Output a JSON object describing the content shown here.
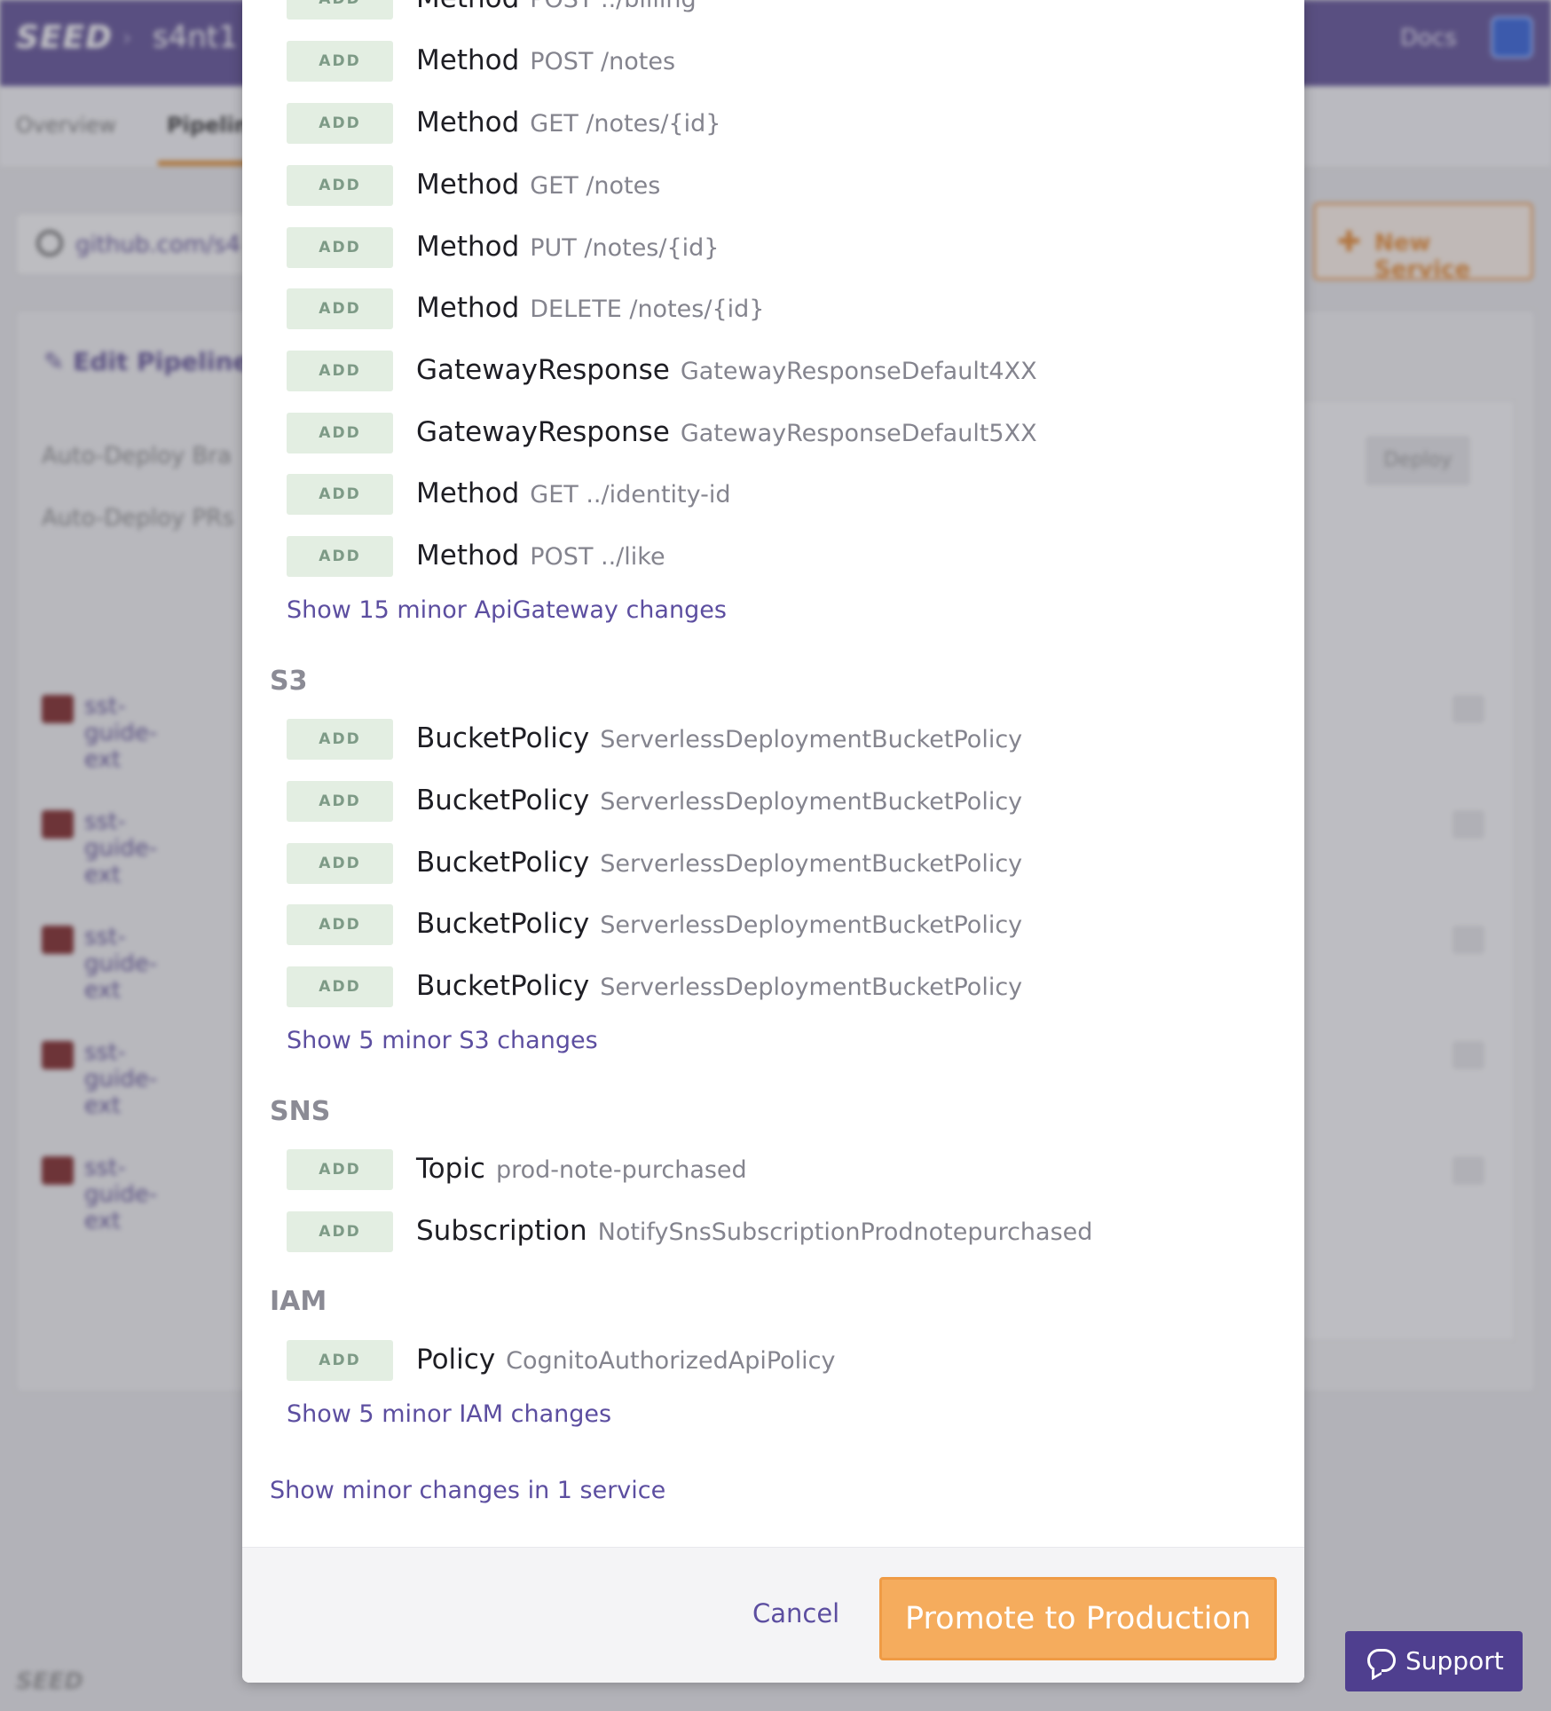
{
  "app": {
    "logo": "SEED",
    "crumb": "s4nt1",
    "docs_label": "Docs",
    "tabs": [
      "Overview",
      "Pipeline"
    ],
    "repo": "github.com/s4",
    "new_service_label": "New Service",
    "edit_pipeline_label": "Edit Pipeline",
    "auto_deploy_branch": "Auto-Deploy Bra",
    "auto_deploy_prs": "Auto-Deploy PRs",
    "deploy_label": "Deploy",
    "service_name": "sst-guide-ext",
    "footer_logo": "SEED"
  },
  "modal": {
    "badge_label": "ADD",
    "top_partial": {
      "type": "Method",
      "name": "POST ../billing"
    },
    "apigateway_changes": [
      {
        "type": "Method",
        "name": "POST /notes"
      },
      {
        "type": "Method",
        "name": "GET /notes/{id}"
      },
      {
        "type": "Method",
        "name": "GET /notes"
      },
      {
        "type": "Method",
        "name": "PUT /notes/{id}"
      },
      {
        "type": "Method",
        "name": "DELETE /notes/{id}"
      },
      {
        "type": "GatewayResponse",
        "name": "GatewayResponseDefault4XX"
      },
      {
        "type": "GatewayResponse",
        "name": "GatewayResponseDefault5XX"
      },
      {
        "type": "Method",
        "name": "GET ../identity-id"
      },
      {
        "type": "Method",
        "name": "POST ../like"
      }
    ],
    "apigateway_minor_link": "Show 15 minor ApiGateway changes",
    "s3": {
      "title": "S3",
      "changes": [
        {
          "type": "BucketPolicy",
          "name": "ServerlessDeploymentBucketPolicy"
        },
        {
          "type": "BucketPolicy",
          "name": "ServerlessDeploymentBucketPolicy"
        },
        {
          "type": "BucketPolicy",
          "name": "ServerlessDeploymentBucketPolicy"
        },
        {
          "type": "BucketPolicy",
          "name": "ServerlessDeploymentBucketPolicy"
        },
        {
          "type": "BucketPolicy",
          "name": "ServerlessDeploymentBucketPolicy"
        }
      ],
      "minor_link": "Show 5 minor S3 changes"
    },
    "sns": {
      "title": "SNS",
      "changes": [
        {
          "type": "Topic",
          "name": "prod-note-purchased"
        },
        {
          "type": "Subscription",
          "name": "NotifySnsSubscriptionProdnotepurchased"
        }
      ]
    },
    "iam": {
      "title": "IAM",
      "changes": [
        {
          "type": "Policy",
          "name": "CognitoAuthorizedApiPolicy"
        }
      ],
      "minor_link": "Show 5 minor IAM changes"
    },
    "service_minor_link": "Show minor changes in 1 service",
    "footer": {
      "cancel_label": "Cancel",
      "promote_label": "Promote to Production"
    }
  },
  "support": {
    "label": "Support"
  },
  "colors": {
    "brand": "#5a4a93",
    "link": "#5c4ea0",
    "promote": "#f5ac5d",
    "badge_bg": "#e3eee2"
  }
}
